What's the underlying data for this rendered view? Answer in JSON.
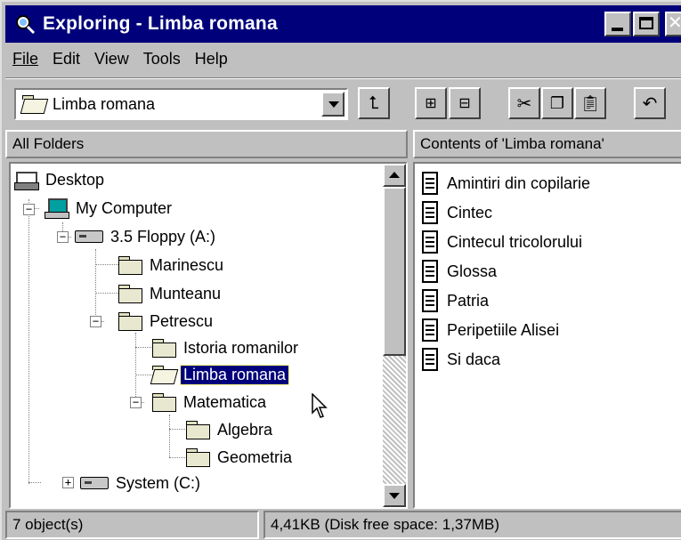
{
  "window": {
    "title": "Exploring - Limba romana",
    "colors": {
      "titlebar": "#00007b",
      "selection": "#00007b",
      "face": "#c0c0c0"
    }
  },
  "menu": [
    {
      "label": "File"
    },
    {
      "label": "Edit"
    },
    {
      "label": "View"
    },
    {
      "label": "Tools"
    },
    {
      "label": "Help"
    }
  ],
  "toolbar": {
    "address_value": "Limba romana",
    "buttons": [
      "up-folder-icon",
      "map-drive-icon",
      "disconnect-drive-icon",
      "cut-icon",
      "copy-icon",
      "paste-icon",
      "undo-icon"
    ]
  },
  "left_pane": {
    "header": "All Folders",
    "tree": [
      {
        "label": "Desktop"
      },
      {
        "label": "My Computer"
      },
      {
        "label": "3.5 Floppy (A:)"
      },
      {
        "label": "Marinescu"
      },
      {
        "label": "Munteanu"
      },
      {
        "label": "Petrescu"
      },
      {
        "label": "Istoria romanilor"
      },
      {
        "label": "Limba romana"
      },
      {
        "label": "Matematica"
      },
      {
        "label": "Algebra"
      },
      {
        "label": "Geometria"
      },
      {
        "label": "System (C:)"
      }
    ]
  },
  "right_pane": {
    "header": "Contents of 'Limba romana'",
    "files": [
      {
        "name": "Amintiri din copilarie"
      },
      {
        "name": "Cintec"
      },
      {
        "name": "Cintecul tricolorului"
      },
      {
        "name": "Glossa"
      },
      {
        "name": "Patria"
      },
      {
        "name": "Peripetiile Alisei"
      },
      {
        "name": "Si daca"
      }
    ]
  },
  "status": {
    "objects": "7 object(s)",
    "space": "4,41KB (Disk free space: 1,37MB)"
  }
}
